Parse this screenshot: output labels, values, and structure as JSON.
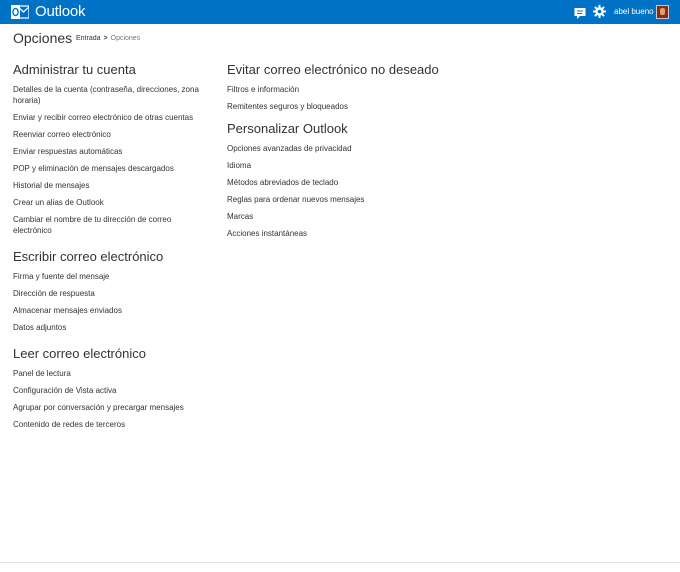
{
  "app": {
    "title": "Outlook",
    "accent_color": "#0072c6",
    "logo_icon": "outlook-logo-icon"
  },
  "topbar": {
    "chat_icon": "chat-icon",
    "settings_icon": "gear-icon",
    "user_name": "abel bueno"
  },
  "page": {
    "title": "Opciones",
    "breadcrumb": {
      "link": "Entrada",
      "separator": ">",
      "current": "Opciones"
    }
  },
  "sections": {
    "account": {
      "title": "Administrar tu cuenta",
      "items": [
        "Detalles de la cuenta (contraseña, direcciones, zona horaria)",
        "Enviar y recibir correo electrónico de otras cuentas",
        "Reenviar correo electrónico",
        "Enviar respuestas automáticas",
        "POP y eliminación de mensajes descargados",
        "Historial de mensajes",
        "Crear un alias de Outlook",
        "Cambiar el nombre de tu dirección de correo electrónico"
      ]
    },
    "write": {
      "title": "Escribir correo electrónico",
      "items": [
        "Firma y fuente del mensaje",
        "Dirección de respuesta",
        "Almacenar mensajes enviados",
        "Datos adjuntos"
      ]
    },
    "read": {
      "title": "Leer correo electrónico",
      "items": [
        "Panel de lectura",
        "Configuración de Vista activa",
        "Agrupar por conversación y precargar mensajes",
        "Contenido de redes de terceros"
      ]
    },
    "junk": {
      "title": "Evitar correo electrónico no deseado",
      "items": [
        "Filtros e información",
        "Remitentes seguros y bloqueados"
      ]
    },
    "customize": {
      "title": "Personalizar Outlook",
      "items": [
        "Opciones avanzadas de privacidad",
        "Idioma",
        "Métodos abreviados de teclado",
        "Reglas para ordenar nuevos mensajes",
        "Marcas",
        "Acciones instantáneas"
      ]
    }
  }
}
